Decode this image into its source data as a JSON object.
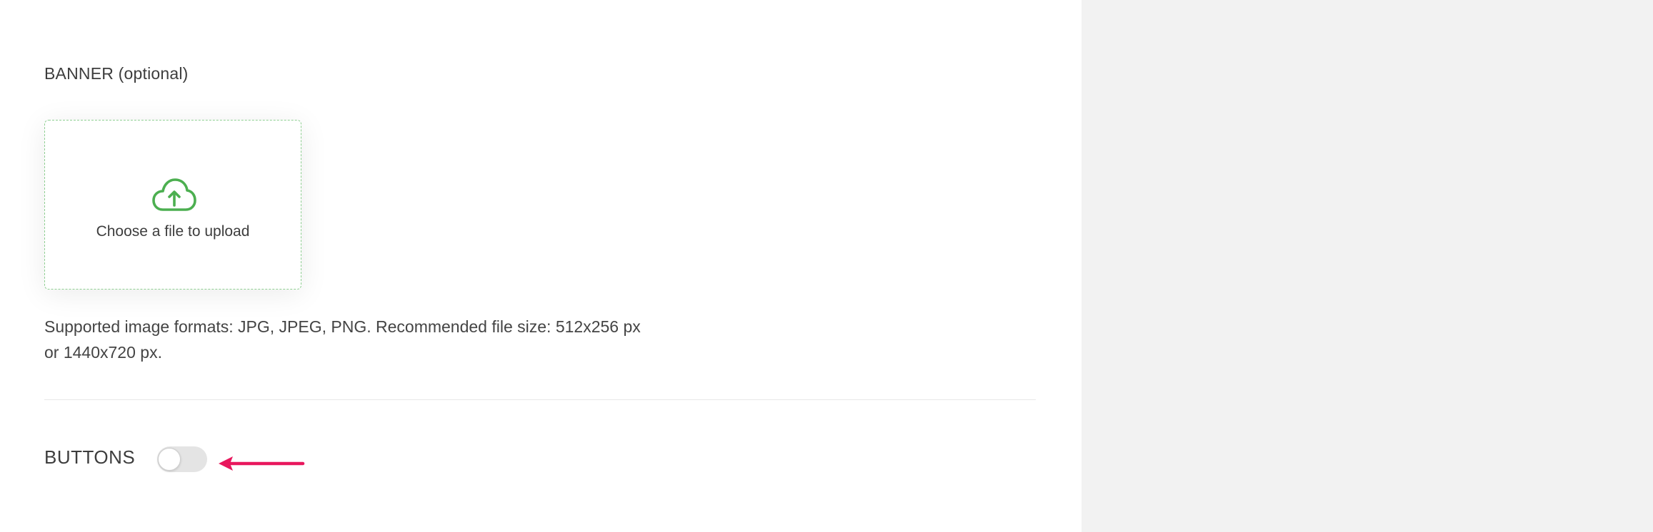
{
  "banner": {
    "label": "BANNER (optional)",
    "upload_text": "Choose a file to upload",
    "upload_icon": "cloud-upload-icon",
    "help_text_line1": "Supported image formats: JPG, JPEG, PNG. Recommended file size: 512x256 px",
    "help_text_line2": "or 1440x720 px."
  },
  "buttons_section": {
    "label": "BUTTONS",
    "toggle_state": "off"
  },
  "colors": {
    "accent_green": "#4caf50",
    "annotation_arrow": "#e8175d",
    "side_panel_bg": "#f2f2f2"
  }
}
